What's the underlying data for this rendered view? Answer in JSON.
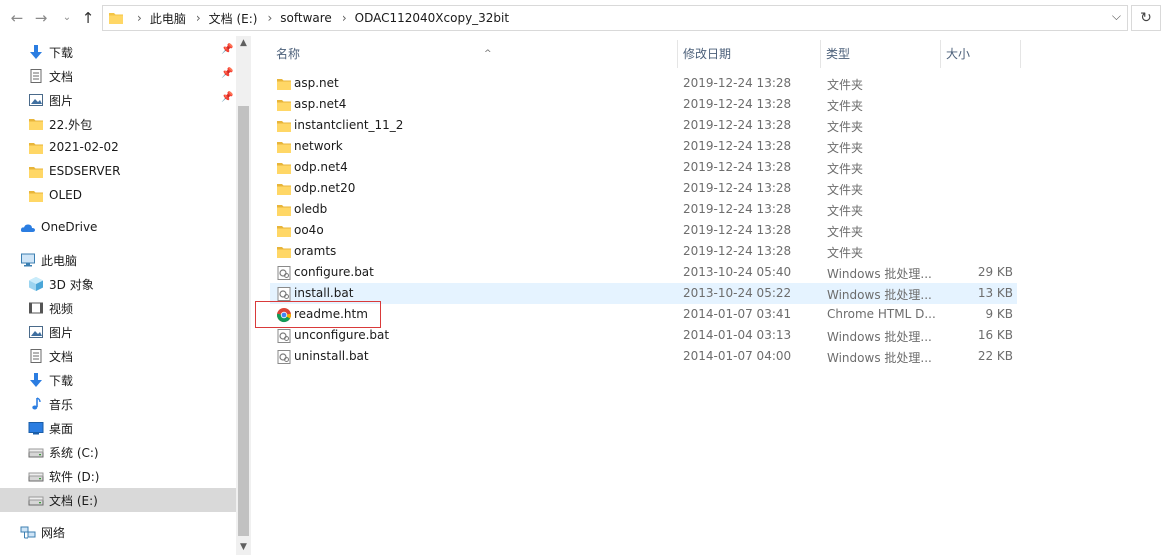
{
  "address_bar": {
    "crumbs": [
      "此电脑",
      "文档 (E:)",
      "software",
      "ODAC112040Xcopy_32bit"
    ]
  },
  "nav_pane": {
    "quick_access": [
      {
        "label": "下载",
        "icon": "download-arrow-icon",
        "pinned": true
      },
      {
        "label": "文档",
        "icon": "document-icon",
        "pinned": true
      },
      {
        "label": "图片",
        "icon": "picture-icon",
        "pinned": true
      },
      {
        "label": "22.外包",
        "icon": "folder-icon",
        "pinned": false
      },
      {
        "label": "2021-02-02",
        "icon": "folder-icon",
        "pinned": false
      },
      {
        "label": "ESDSERVER",
        "icon": "folder-icon",
        "pinned": false
      },
      {
        "label": "OLED",
        "icon": "folder-icon",
        "pinned": false
      }
    ],
    "onedrive": {
      "label": "OneDrive",
      "icon": "cloud-icon"
    },
    "this_pc": {
      "label": "此电脑",
      "icon": "computer-icon"
    },
    "pc_items": [
      {
        "label": "3D 对象",
        "icon": "cube-3d-icon"
      },
      {
        "label": "视频",
        "icon": "video-icon"
      },
      {
        "label": "图片",
        "icon": "picture-icon"
      },
      {
        "label": "文档",
        "icon": "document-icon"
      },
      {
        "label": "下载",
        "icon": "download-arrow-icon"
      },
      {
        "label": "音乐",
        "icon": "music-note-icon"
      },
      {
        "label": "桌面",
        "icon": "desktop-icon"
      },
      {
        "label": "系统 (C:)",
        "icon": "drive-icon"
      },
      {
        "label": "软件 (D:)",
        "icon": "drive-icon"
      },
      {
        "label": "文档 (E:)",
        "icon": "drive-icon",
        "selected": true
      }
    ],
    "network": {
      "label": "网络",
      "icon": "network-icon"
    }
  },
  "columns": {
    "name": "名称",
    "date": "修改日期",
    "type": "类型",
    "size": "大小"
  },
  "files": [
    {
      "name": "asp.net",
      "date": "2019-12-24 13:28",
      "type": "文件夹",
      "size": "",
      "icon": "folder-icon"
    },
    {
      "name": "asp.net4",
      "date": "2019-12-24 13:28",
      "type": "文件夹",
      "size": "",
      "icon": "folder-icon"
    },
    {
      "name": "instantclient_11_2",
      "date": "2019-12-24 13:28",
      "type": "文件夹",
      "size": "",
      "icon": "folder-icon"
    },
    {
      "name": "network",
      "date": "2019-12-24 13:28",
      "type": "文件夹",
      "size": "",
      "icon": "folder-icon"
    },
    {
      "name": "odp.net4",
      "date": "2019-12-24 13:28",
      "type": "文件夹",
      "size": "",
      "icon": "folder-icon"
    },
    {
      "name": "odp.net20",
      "date": "2019-12-24 13:28",
      "type": "文件夹",
      "size": "",
      "icon": "folder-icon"
    },
    {
      "name": "oledb",
      "date": "2019-12-24 13:28",
      "type": "文件夹",
      "size": "",
      "icon": "folder-icon"
    },
    {
      "name": "oo4o",
      "date": "2019-12-24 13:28",
      "type": "文件夹",
      "size": "",
      "icon": "folder-icon"
    },
    {
      "name": "oramts",
      "date": "2019-12-24 13:28",
      "type": "文件夹",
      "size": "",
      "icon": "folder-icon"
    },
    {
      "name": "configure.bat",
      "date": "2013-10-24 05:40",
      "type": "Windows 批处理...",
      "size": "29 KB",
      "icon": "batch-file-icon"
    },
    {
      "name": "install.bat",
      "date": "2013-10-24 05:22",
      "type": "Windows 批处理...",
      "size": "13 KB",
      "icon": "batch-file-icon",
      "hover": true
    },
    {
      "name": "readme.htm",
      "date": "2014-01-07 03:41",
      "type": "Chrome HTML D...",
      "size": "9 KB",
      "icon": "chrome-icon",
      "highlighted": true
    },
    {
      "name": "unconfigure.bat",
      "date": "2014-01-04 03:13",
      "type": "Windows 批处理...",
      "size": "16 KB",
      "icon": "batch-file-icon"
    },
    {
      "name": "uninstall.bat",
      "date": "2014-01-07 04:00",
      "type": "Windows 批处理...",
      "size": "22 KB",
      "icon": "batch-file-icon"
    }
  ],
  "colors": {
    "folder": "#f4c545",
    "selected_bg": "#d9d9d9",
    "hover_bg": "#e5f3ff",
    "highlight_border": "#d93a3a",
    "header_text": "#4c607a"
  }
}
